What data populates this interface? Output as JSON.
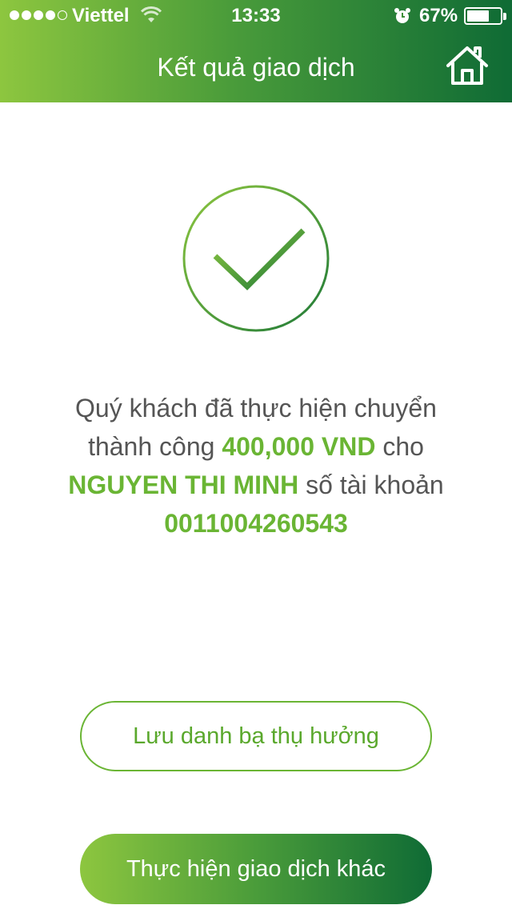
{
  "status_bar": {
    "carrier": "Viettel",
    "time": "13:33",
    "battery_percent": "67%",
    "battery_level": 0.67,
    "signal_bars": 4,
    "signal_total": 5
  },
  "header": {
    "title": "Kết quả giao dịch",
    "home_icon": "home-icon"
  },
  "result": {
    "icon": "checkmark-circle-icon",
    "line_prefix": "Quý khách đã thực hiện chuyển thành công ",
    "amount": "400,000 VND",
    "to_text": " cho ",
    "recipient": "NGUYEN THI MINH",
    "account_text": " số tài khoản ",
    "account_number": "0011004260543"
  },
  "actions": {
    "save_contact_label": "Lưu danh bạ thụ hưởng",
    "new_transaction_label": "Thực hiện giao dịch khác"
  },
  "colors": {
    "brand_light": "#8dc63f",
    "brand_dark": "#0f6b35",
    "highlight": "#6ab534",
    "text": "#555555"
  }
}
